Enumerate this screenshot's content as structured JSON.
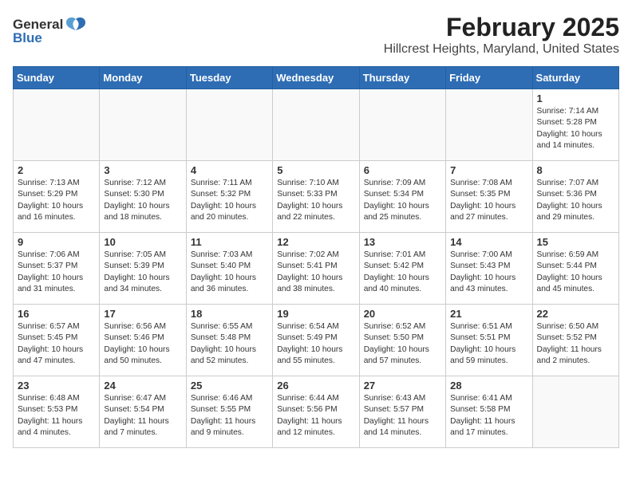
{
  "header": {
    "logo_general": "General",
    "logo_blue": "Blue",
    "month_year": "February 2025",
    "location": "Hillcrest Heights, Maryland, United States"
  },
  "weekdays": [
    "Sunday",
    "Monday",
    "Tuesday",
    "Wednesday",
    "Thursday",
    "Friday",
    "Saturday"
  ],
  "weeks": [
    [
      {
        "day": "",
        "detail": ""
      },
      {
        "day": "",
        "detail": ""
      },
      {
        "day": "",
        "detail": ""
      },
      {
        "day": "",
        "detail": ""
      },
      {
        "day": "",
        "detail": ""
      },
      {
        "day": "",
        "detail": ""
      },
      {
        "day": "1",
        "detail": "Sunrise: 7:14 AM\nSunset: 5:28 PM\nDaylight: 10 hours\nand 14 minutes."
      }
    ],
    [
      {
        "day": "2",
        "detail": "Sunrise: 7:13 AM\nSunset: 5:29 PM\nDaylight: 10 hours\nand 16 minutes."
      },
      {
        "day": "3",
        "detail": "Sunrise: 7:12 AM\nSunset: 5:30 PM\nDaylight: 10 hours\nand 18 minutes."
      },
      {
        "day": "4",
        "detail": "Sunrise: 7:11 AM\nSunset: 5:32 PM\nDaylight: 10 hours\nand 20 minutes."
      },
      {
        "day": "5",
        "detail": "Sunrise: 7:10 AM\nSunset: 5:33 PM\nDaylight: 10 hours\nand 22 minutes."
      },
      {
        "day": "6",
        "detail": "Sunrise: 7:09 AM\nSunset: 5:34 PM\nDaylight: 10 hours\nand 25 minutes."
      },
      {
        "day": "7",
        "detail": "Sunrise: 7:08 AM\nSunset: 5:35 PM\nDaylight: 10 hours\nand 27 minutes."
      },
      {
        "day": "8",
        "detail": "Sunrise: 7:07 AM\nSunset: 5:36 PM\nDaylight: 10 hours\nand 29 minutes."
      }
    ],
    [
      {
        "day": "9",
        "detail": "Sunrise: 7:06 AM\nSunset: 5:37 PM\nDaylight: 10 hours\nand 31 minutes."
      },
      {
        "day": "10",
        "detail": "Sunrise: 7:05 AM\nSunset: 5:39 PM\nDaylight: 10 hours\nand 34 minutes."
      },
      {
        "day": "11",
        "detail": "Sunrise: 7:03 AM\nSunset: 5:40 PM\nDaylight: 10 hours\nand 36 minutes."
      },
      {
        "day": "12",
        "detail": "Sunrise: 7:02 AM\nSunset: 5:41 PM\nDaylight: 10 hours\nand 38 minutes."
      },
      {
        "day": "13",
        "detail": "Sunrise: 7:01 AM\nSunset: 5:42 PM\nDaylight: 10 hours\nand 40 minutes."
      },
      {
        "day": "14",
        "detail": "Sunrise: 7:00 AM\nSunset: 5:43 PM\nDaylight: 10 hours\nand 43 minutes."
      },
      {
        "day": "15",
        "detail": "Sunrise: 6:59 AM\nSunset: 5:44 PM\nDaylight: 10 hours\nand 45 minutes."
      }
    ],
    [
      {
        "day": "16",
        "detail": "Sunrise: 6:57 AM\nSunset: 5:45 PM\nDaylight: 10 hours\nand 47 minutes."
      },
      {
        "day": "17",
        "detail": "Sunrise: 6:56 AM\nSunset: 5:46 PM\nDaylight: 10 hours\nand 50 minutes."
      },
      {
        "day": "18",
        "detail": "Sunrise: 6:55 AM\nSunset: 5:48 PM\nDaylight: 10 hours\nand 52 minutes."
      },
      {
        "day": "19",
        "detail": "Sunrise: 6:54 AM\nSunset: 5:49 PM\nDaylight: 10 hours\nand 55 minutes."
      },
      {
        "day": "20",
        "detail": "Sunrise: 6:52 AM\nSunset: 5:50 PM\nDaylight: 10 hours\nand 57 minutes."
      },
      {
        "day": "21",
        "detail": "Sunrise: 6:51 AM\nSunset: 5:51 PM\nDaylight: 10 hours\nand 59 minutes."
      },
      {
        "day": "22",
        "detail": "Sunrise: 6:50 AM\nSunset: 5:52 PM\nDaylight: 11 hours\nand 2 minutes."
      }
    ],
    [
      {
        "day": "23",
        "detail": "Sunrise: 6:48 AM\nSunset: 5:53 PM\nDaylight: 11 hours\nand 4 minutes."
      },
      {
        "day": "24",
        "detail": "Sunrise: 6:47 AM\nSunset: 5:54 PM\nDaylight: 11 hours\nand 7 minutes."
      },
      {
        "day": "25",
        "detail": "Sunrise: 6:46 AM\nSunset: 5:55 PM\nDaylight: 11 hours\nand 9 minutes."
      },
      {
        "day": "26",
        "detail": "Sunrise: 6:44 AM\nSunset: 5:56 PM\nDaylight: 11 hours\nand 12 minutes."
      },
      {
        "day": "27",
        "detail": "Sunrise: 6:43 AM\nSunset: 5:57 PM\nDaylight: 11 hours\nand 14 minutes."
      },
      {
        "day": "28",
        "detail": "Sunrise: 6:41 AM\nSunset: 5:58 PM\nDaylight: 11 hours\nand 17 minutes."
      },
      {
        "day": "",
        "detail": ""
      }
    ]
  ]
}
